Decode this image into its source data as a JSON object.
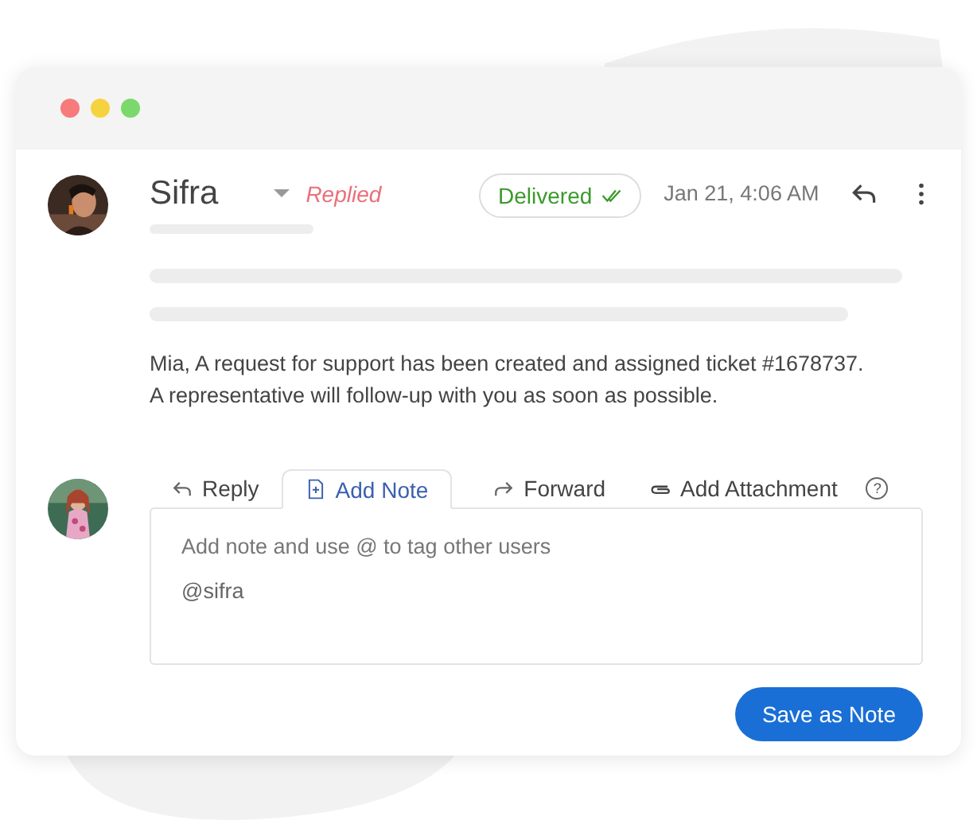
{
  "window": {
    "controls": [
      {
        "color": "#f77b7b"
      },
      {
        "color": "#f5d33f"
      },
      {
        "color": "#7bd86b"
      }
    ]
  },
  "message": {
    "avatar": {
      "kind": "picture"
    },
    "sender": "Sifra",
    "status": "Replied",
    "delivery": "Delivered",
    "time": "Jan 21, 4:06 AM",
    "body": [
      "Mia, A request for support has been created and assigned ticket #1678737.",
      "A representative will follow-up with you as soon as possible."
    ]
  },
  "composer": {
    "avatar": {
      "kind": "picture"
    },
    "tabs": [
      {
        "label": "Reply",
        "kind": "reply",
        "selected": false
      },
      {
        "label": "Add Note",
        "kind": "note",
        "selected": true
      },
      {
        "label": "Forward",
        "kind": "forward",
        "selected": false
      },
      {
        "label": "Add Attachment",
        "kind": "attachment",
        "selected": false
      }
    ],
    "help": "?",
    "note": {
      "placeholder": "Add note and use @ to tag other users",
      "value": "@sifra"
    },
    "button": "Save as Note"
  }
}
